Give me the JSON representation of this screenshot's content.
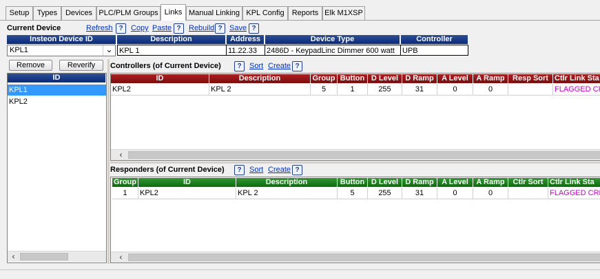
{
  "tabs": [
    "Setup",
    "Types",
    "Devices",
    "PLC/PLM Groups",
    "Links",
    "Manual Linking",
    "KPL Config",
    "Reports",
    "Elk M1XSP"
  ],
  "active_tab": "Links",
  "current_device": {
    "label": "Current Device",
    "links": [
      "Refresh",
      "Copy",
      "Paste",
      "Rebuild",
      "Save"
    ],
    "help": "?"
  },
  "device_headers": {
    "id": "Insteon Device ID",
    "description": "Description",
    "address": "Address",
    "device_type": "Device Type",
    "controller": "Controller"
  },
  "device": {
    "id": "KPL1",
    "description": "KPL 1",
    "address": "11.22.33",
    "device_type": "2486D - KeypadLinc Dimmer 600 watt",
    "controller": "UPB"
  },
  "left": {
    "remove": "Remove",
    "reverify": "Reverify",
    "id_header": "ID",
    "items": [
      "KPL1",
      "KPL2"
    ],
    "selected": "KPL1"
  },
  "controllers": {
    "title": "Controllers (of Current Device)",
    "sort": "Sort",
    "create": "Create",
    "columns": [
      "ID",
      "Description",
      "Group",
      "Button",
      "D Level",
      "D Ramp",
      "A Level",
      "A Ramp",
      "Resp Sort",
      "Ctlr Link Sta"
    ],
    "rows": [
      {
        "id": "KPL2",
        "description": "KPL 2",
        "group": "5",
        "button": "1",
        "d_level": "255",
        "d_ramp": "31",
        "a_level": "0",
        "a_ramp": "0",
        "resp_sort": "",
        "status": "FLAGGED CR"
      }
    ]
  },
  "responders": {
    "title": "Responders (of Current Device)",
    "sort": "Sort",
    "create": "Create",
    "columns": [
      "Group",
      "ID",
      "Description",
      "Button",
      "D Level",
      "D Ramp",
      "A Level",
      "A Ramp",
      "Ctlr Sort",
      "Ctlr Link Sta"
    ],
    "rows": [
      {
        "group": "1",
        "id": "KPL2",
        "description": "KPL 2",
        "button": "5",
        "d_level": "255",
        "d_ramp": "31",
        "a_level": "0",
        "a_ramp": "0",
        "ctlr_sort": "",
        "status": "FLAGGED CRE"
      }
    ]
  },
  "icons": {
    "scroll_left": "‹",
    "dropdown": "⌄",
    "help": "?"
  },
  "colors": {
    "blue_header": "#0b2a76",
    "red_header": "#7a0d0d",
    "green_header": "#0e6a0e",
    "selection": "#3399ff",
    "status_magenta": "#cc00cc"
  }
}
